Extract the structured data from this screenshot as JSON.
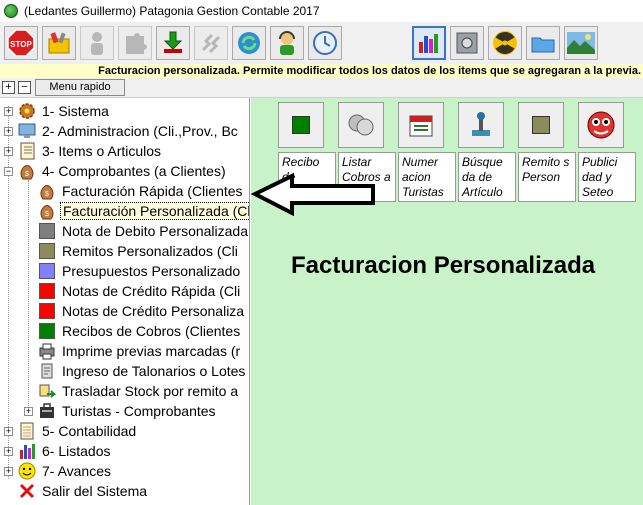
{
  "window": {
    "title": "(Ledantes Guillermo) Patagonia Gestion Contable 2017"
  },
  "toolbar": {
    "hint": "Facturacion personalizada. Permite modificar todos los datos de los items que se agregaran a la previa.",
    "buttons": [
      {
        "name": "stop-button",
        "icon": "stop-sign-icon",
        "label": "STOP"
      },
      {
        "name": "tools-button",
        "icon": "tools-icon"
      },
      {
        "name": "user-button",
        "icon": "person-icon"
      },
      {
        "name": "puzzle-button",
        "icon": "puzzle-icon"
      },
      {
        "name": "download-button",
        "icon": "down-arrow-icon"
      },
      {
        "name": "steps-button",
        "icon": "steps-icon"
      },
      {
        "name": "refresh-button",
        "icon": "refresh-icon"
      },
      {
        "name": "support-button",
        "icon": "support-agent-icon"
      },
      {
        "name": "clock-button",
        "icon": "clock-icon"
      },
      {
        "name": "chart-button",
        "icon": "bar-chart-icon"
      },
      {
        "name": "safe-button",
        "icon": "safe-icon"
      },
      {
        "name": "radiation-button",
        "icon": "radiation-icon"
      },
      {
        "name": "folder-button",
        "icon": "folder-icon"
      },
      {
        "name": "landscape-button",
        "icon": "landscape-icon"
      }
    ]
  },
  "subbar": {
    "expand": "+",
    "collapse": "−",
    "menu_rapido": "Menu rapido"
  },
  "tree": {
    "items": [
      {
        "label": "1- Sistema"
      },
      {
        "label": "2- Administracion (Cli.,Prov., Bc"
      },
      {
        "label": "3- Items o Articulos"
      },
      {
        "label": "4- Comprobantes (a Clientes)"
      },
      {
        "label": "Facturación Rápida (Clientes"
      },
      {
        "label": "Facturación Personalizada (Clientes"
      },
      {
        "label": "Nota de Debito Personalizada"
      },
      {
        "label": "Remitos Personalizados (Cli"
      },
      {
        "label": "Presupuestos Personalizado"
      },
      {
        "label": "Notas de Crédito Rápida (Cli"
      },
      {
        "label": "Notas de Crédito Personaliza"
      },
      {
        "label": "Recibos de Cobros (Clientes"
      },
      {
        "label": "Imprime previas marcadas (r"
      },
      {
        "label": "Ingreso de Talonarios o Lotes"
      },
      {
        "label": "Trasladar Stock por remito a"
      },
      {
        "label": "Turistas - Comprobantes"
      },
      {
        "label": "5- Contabilidad"
      },
      {
        "label": "6- Listados"
      },
      {
        "label": "7- Avances"
      },
      {
        "label": "Salir del Sistema"
      }
    ],
    "colors": {
      "nota_debito": "#7f7f7f",
      "remitos": "#8b8b5c",
      "presupuestos": "#8080ff",
      "notas_credito": "#ff0000",
      "recibos": "#008000"
    }
  },
  "main": {
    "quick_buttons": [
      {
        "label": "Recibo de Cobros",
        "icon": "green-square-icon"
      },
      {
        "label": "Listar Cobros a",
        "icon": "coins-icon"
      },
      {
        "label": "Numer acion Turistas",
        "icon": "calendar-icon"
      },
      {
        "label": "Búsque da de Artículo",
        "icon": "joystick-icon"
      },
      {
        "label": "Remito s Person",
        "icon": "olive-square-icon"
      },
      {
        "label": "Publici dad y Seteo",
        "icon": "mascot-icon"
      }
    ],
    "title": "Facturacion Personalizada"
  }
}
